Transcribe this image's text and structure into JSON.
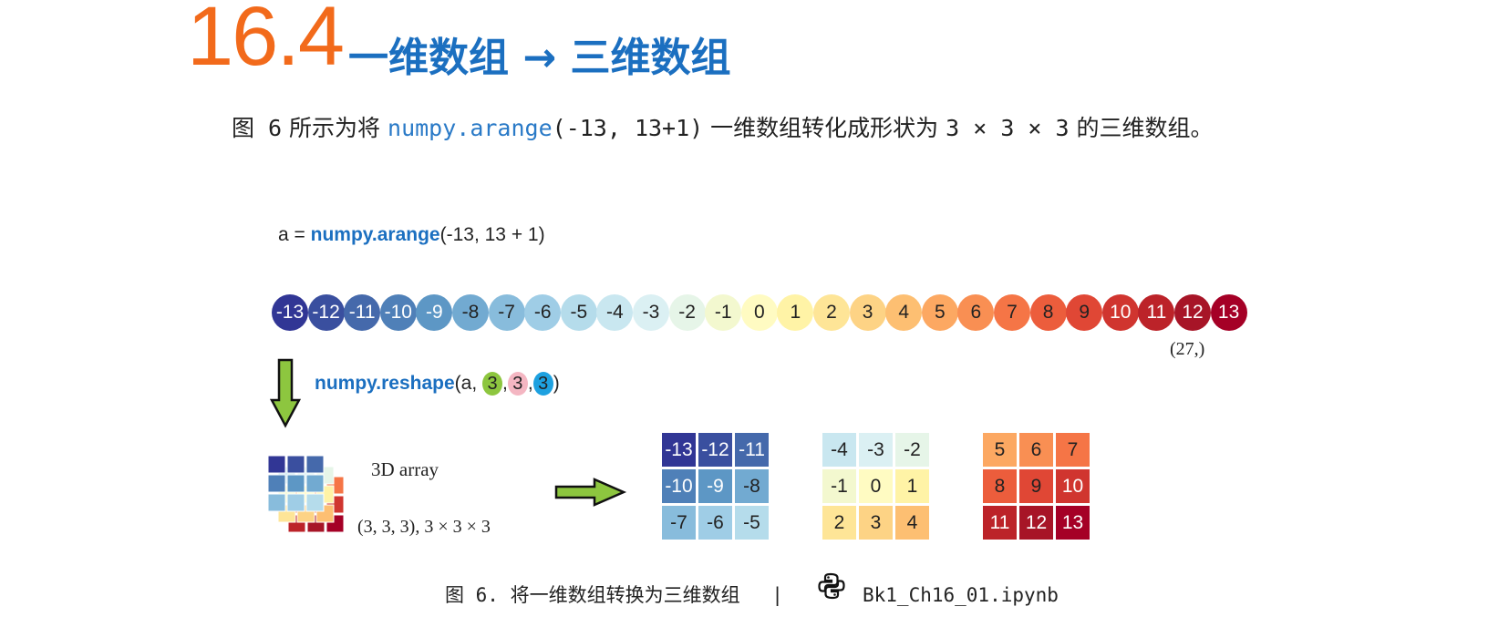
{
  "section": {
    "number": "16.4",
    "title": "一维数组 → 三维数组"
  },
  "intro": {
    "fig_ref": "图 6",
    "text_before_code": " 所示为将 ",
    "code": "numpy.arange",
    "args": "(-13, 13+1)",
    "text_after": " 一维数组转化成形状为 ",
    "shape": "3 × 3 × 3",
    "text_end": " 的三维数组。"
  },
  "figure": {
    "arange_line": {
      "prefix": "a = ",
      "fn": "numpy.arange",
      "args": "(-13, 13 + 1)"
    },
    "values": [
      -13,
      -12,
      -11,
      -10,
      -9,
      -8,
      -7,
      -6,
      -5,
      -4,
      -3,
      -2,
      -1,
      0,
      1,
      2,
      3,
      4,
      5,
      6,
      7,
      8,
      9,
      10,
      11,
      12,
      13
    ],
    "shape_1d": "(27,)",
    "reshape_line": {
      "fn": "numpy.reshape",
      "open": "(a, ",
      "dims": [
        "3",
        "3",
        "3"
      ],
      "sep": ",",
      "close": ")"
    },
    "label_3d": "3D array",
    "shape_3d": "(3, 3, 3), 3 × 3 × 3",
    "slices": [
      [
        [
          -13,
          -12,
          -11
        ],
        [
          -10,
          -9,
          -8
        ],
        [
          -7,
          -6,
          -5
        ]
      ],
      [
        [
          -4,
          -3,
          -2
        ],
        [
          -1,
          0,
          1
        ],
        [
          2,
          3,
          4
        ]
      ],
      [
        [
          5,
          6,
          7
        ],
        [
          8,
          9,
          10
        ],
        [
          11,
          12,
          13
        ]
      ]
    ],
    "colors": {
      "-13": "#313695",
      "-12": "#3a4f9f",
      "-11": "#4569ab",
      "-10": "#4f80b8",
      "-9": "#5d97c5",
      "-8": "#72aad1",
      "-7": "#88bcdc",
      "-6": "#9fcde6",
      "-5": "#b5dceb",
      "-4": "#c9e7f0",
      "-3": "#dbf0f3",
      "-2": "#e6f5e8",
      "-1": "#f3f8cf",
      "0": "#fffbc2",
      "1": "#fff3a6",
      "2": "#fee597",
      "3": "#fdd385",
      "4": "#fdbf72",
      "5": "#fca862",
      "6": "#f98f53",
      "7": "#f57546",
      "8": "#ec5d3c",
      "9": "#e04735",
      "10": "#d0352f",
      "11": "#bc2329",
      "12": "#a71527",
      "13": "#a50026"
    },
    "dim_colors": [
      "#8dc63f",
      "#f4b6c2",
      "#1ea1e0"
    ],
    "arrow_color": "#8dc63f"
  },
  "caption": {
    "text": "图 6. 将一维数组转换为三维数组",
    "separator": "|",
    "file": "Bk1_Ch16_01.ipynb",
    "icon": "python-icon"
  }
}
